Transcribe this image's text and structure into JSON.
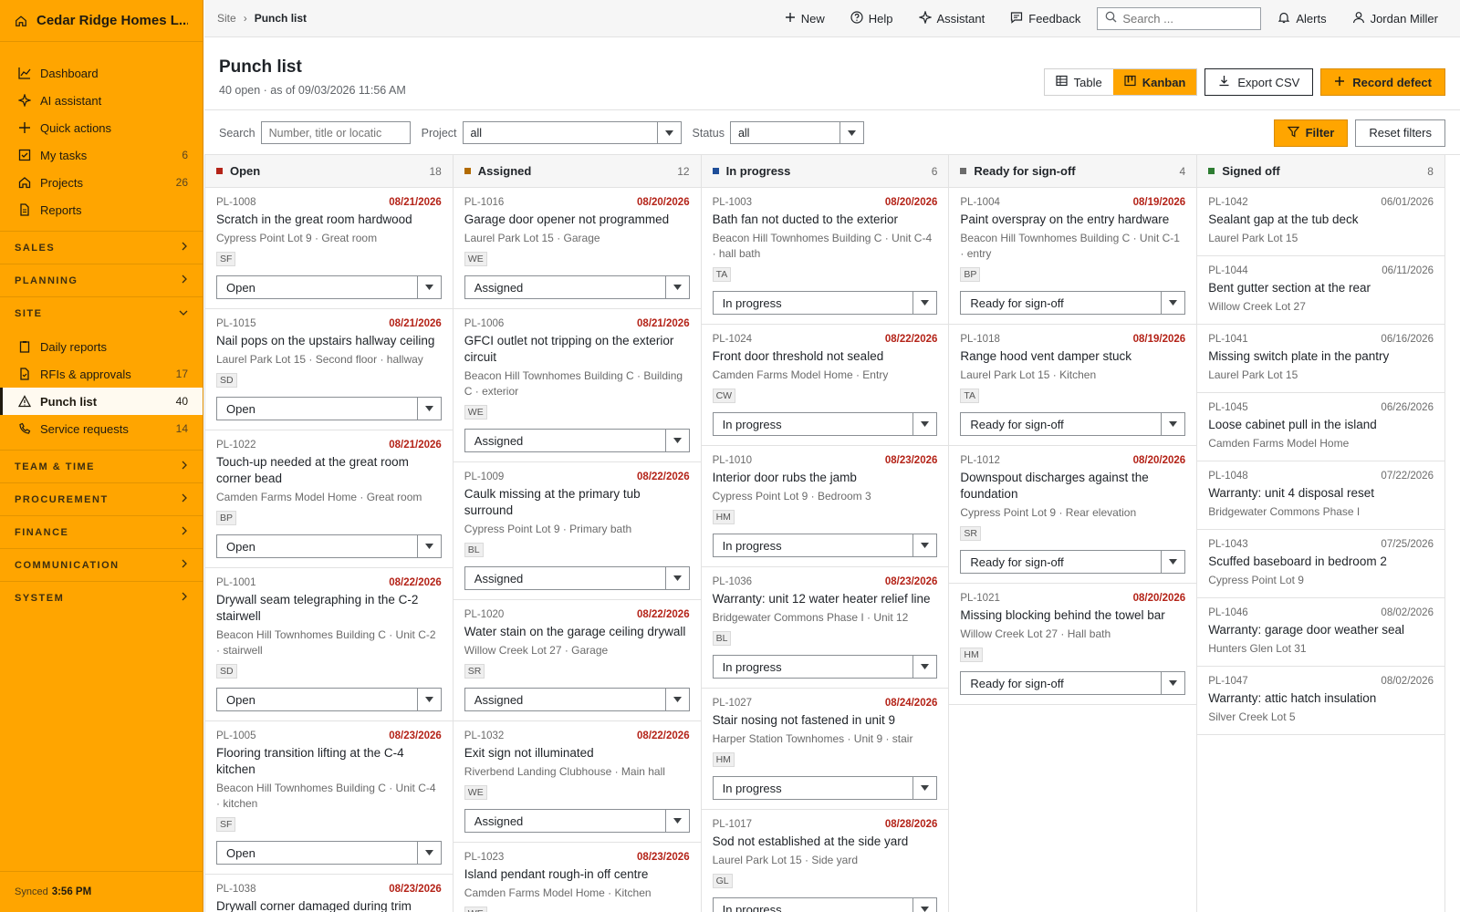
{
  "app": {
    "name": "Cedar Ridge Homes L...",
    "synced_label": "Synced",
    "synced_time": "3:56 PM"
  },
  "sidebar": {
    "top_items": [
      {
        "label": "Dashboard",
        "icon": "chart-line-icon",
        "count": ""
      },
      {
        "label": "AI assistant",
        "icon": "sparkle-icon",
        "count": ""
      },
      {
        "label": "Quick actions",
        "icon": "plus-icon",
        "count": ""
      },
      {
        "label": "My tasks",
        "icon": "checkbox-icon",
        "count": "6"
      },
      {
        "label": "Projects",
        "icon": "home-icon",
        "count": "26"
      },
      {
        "label": "Reports",
        "icon": "document-icon",
        "count": ""
      }
    ],
    "sections": {
      "sales": "SALES",
      "planning": "PLANNING",
      "site": "SITE",
      "team_time": "TEAM & TIME",
      "procurement": "PROCUREMENT",
      "finance": "FINANCE",
      "communication": "COMMUNICATION",
      "system": "SYSTEM"
    },
    "site_items": [
      {
        "label": "Daily reports",
        "icon": "clipboard-icon",
        "count": ""
      },
      {
        "label": "RFIs & approvals",
        "icon": "file-check-icon",
        "count": "17"
      },
      {
        "label": "Punch list",
        "icon": "warning-icon",
        "count": "40"
      },
      {
        "label": "Service requests",
        "icon": "phone-icon",
        "count": "14"
      }
    ]
  },
  "topbar": {
    "breadcrumb_parent": "Site",
    "breadcrumb_sep": "›",
    "breadcrumb_current": "Punch list",
    "new_label": "New",
    "help_label": "Help",
    "assistant_label": "Assistant",
    "feedback_label": "Feedback",
    "search_placeholder": "Search ...",
    "alerts_label": "Alerts",
    "user_name": "Jordan Miller"
  },
  "header": {
    "title": "Punch list",
    "subtitle": "40 open · as of 09/03/2026 11:56 AM",
    "view_table": "Table",
    "view_kanban": "Kanban",
    "export_label": "Export CSV",
    "record_label": "Record defect"
  },
  "filters": {
    "search_label": "Search",
    "search_placeholder": "Number, title or locatic",
    "project_label": "Project",
    "project_value": "all",
    "status_label": "Status",
    "status_value": "all",
    "filter_label": "Filter",
    "reset_label": "Reset filters"
  },
  "colors": {
    "accent": "#ffa500",
    "overdue": "#b42318"
  },
  "columns": [
    {
      "title": "Open",
      "count": "18",
      "color": "#b42318",
      "cards": [
        {
          "id": "PL-1008",
          "date": "08/21/2026",
          "title": "Scratch in the great room hardwood",
          "loc": "Cypress Point Lot 9 · Great room",
          "assignee": "SF",
          "status": "Open"
        },
        {
          "id": "PL-1015",
          "date": "08/21/2026",
          "title": "Nail pops on the upstairs hallway ceiling",
          "loc": "Laurel Park Lot 15 · Second floor · hallway",
          "assignee": "SD",
          "status": "Open"
        },
        {
          "id": "PL-1022",
          "date": "08/21/2026",
          "title": "Touch-up needed at the great room corner bead",
          "loc": "Camden Farms Model Home · Great room",
          "assignee": "BP",
          "status": "Open"
        },
        {
          "id": "PL-1001",
          "date": "08/22/2026",
          "title": "Drywall seam telegraphing in the C-2 stairwell",
          "loc": "Beacon Hill Townhomes Building C · Unit C-2 · stairwell",
          "assignee": "SD",
          "status": "Open"
        },
        {
          "id": "PL-1005",
          "date": "08/23/2026",
          "title": "Flooring transition lifting at the C-4 kitchen",
          "loc": "Beacon Hill Townhomes Building C · Unit C-4 · kitchen",
          "assignee": "SF",
          "status": "Open"
        },
        {
          "id": "PL-1038",
          "date": "08/23/2026",
          "title": "Drywall corner damaged during trim",
          "loc": "",
          "assignee": "",
          "status": ""
        }
      ]
    },
    {
      "title": "Assigned",
      "count": "12",
      "color": "#b26b00",
      "cards": [
        {
          "id": "PL-1016",
          "date": "08/20/2026",
          "title": "Garage door opener not programmed",
          "loc": "Laurel Park Lot 15 · Garage",
          "assignee": "WE",
          "status": "Assigned"
        },
        {
          "id": "PL-1006",
          "date": "08/21/2026",
          "title": "GFCI outlet not tripping on the exterior circuit",
          "loc": "Beacon Hill Townhomes Building C · Building C · exterior",
          "assignee": "WE",
          "status": "Assigned"
        },
        {
          "id": "PL-1009",
          "date": "08/22/2026",
          "title": "Caulk missing at the primary tub surround",
          "loc": "Cypress Point Lot 9 · Primary bath",
          "assignee": "BL",
          "status": "Assigned"
        },
        {
          "id": "PL-1020",
          "date": "08/22/2026",
          "title": "Water stain on the garage ceiling drywall",
          "loc": "Willow Creek Lot 27 · Garage",
          "assignee": "SR",
          "status": "Assigned"
        },
        {
          "id": "PL-1032",
          "date": "08/22/2026",
          "title": "Exit sign not illuminated",
          "loc": "Riverbend Landing Clubhouse · Main hall",
          "assignee": "WE",
          "status": "Assigned"
        },
        {
          "id": "PL-1023",
          "date": "08/23/2026",
          "title": "Island pendant rough-in off centre",
          "loc": "Camden Farms Model Home · Kitchen",
          "assignee": "WE",
          "status": ""
        }
      ]
    },
    {
      "title": "In progress",
      "count": "6",
      "color": "#1f4e99",
      "cards": [
        {
          "id": "PL-1003",
          "date": "08/20/2026",
          "title": "Bath fan not ducted to the exterior",
          "loc": "Beacon Hill Townhomes Building C · Unit C-4 · hall bath",
          "assignee": "TA",
          "status": "In progress"
        },
        {
          "id": "PL-1024",
          "date": "08/22/2026",
          "title": "Front door threshold not sealed",
          "loc": "Camden Farms Model Home · Entry",
          "assignee": "CW",
          "status": "In progress"
        },
        {
          "id": "PL-1010",
          "date": "08/23/2026",
          "title": "Interior door rubs the jamb",
          "loc": "Cypress Point Lot 9 · Bedroom 3",
          "assignee": "HM",
          "status": "In progress"
        },
        {
          "id": "PL-1036",
          "date": "08/23/2026",
          "title": "Warranty: unit 12 water heater relief line",
          "loc": "Bridgewater Commons Phase I · Unit 12",
          "assignee": "BL",
          "status": "In progress"
        },
        {
          "id": "PL-1027",
          "date": "08/24/2026",
          "title": "Stair nosing not fastened in unit 9",
          "loc": "Harper Station Townhomes · Unit 9 · stair",
          "assignee": "HM",
          "status": "In progress"
        },
        {
          "id": "PL-1017",
          "date": "08/28/2026",
          "title": "Sod not established at the side yard",
          "loc": "Laurel Park Lot 15 · Side yard",
          "assignee": "GL",
          "status": "In progress"
        }
      ]
    },
    {
      "title": "Ready for sign-off",
      "count": "4",
      "color": "#6b6b6b",
      "cards": [
        {
          "id": "PL-1004",
          "date": "08/19/2026",
          "title": "Paint overspray on the entry hardware",
          "loc": "Beacon Hill Townhomes Building C · Unit C-1 · entry",
          "assignee": "BP",
          "status": "Ready for sign-off"
        },
        {
          "id": "PL-1018",
          "date": "08/19/2026",
          "title": "Range hood vent damper stuck",
          "loc": "Laurel Park Lot 15 · Kitchen",
          "assignee": "TA",
          "status": "Ready for sign-off"
        },
        {
          "id": "PL-1012",
          "date": "08/20/2026",
          "title": "Downspout discharges against the foundation",
          "loc": "Cypress Point Lot 9 · Rear elevation",
          "assignee": "SR",
          "status": "Ready for sign-off"
        },
        {
          "id": "PL-1021",
          "date": "08/20/2026",
          "title": "Missing blocking behind the towel bar",
          "loc": "Willow Creek Lot 27 · Hall bath",
          "assignee": "HM",
          "status": "Ready for sign-off"
        }
      ]
    },
    {
      "title": "Signed off",
      "count": "8",
      "color": "#2e7d32",
      "cards": [
        {
          "id": "PL-1042",
          "date": "06/01/2026",
          "title": "Sealant gap at the tub deck",
          "loc": "Laurel Park Lot 15",
          "assignee": "",
          "status": ""
        },
        {
          "id": "PL-1044",
          "date": "06/11/2026",
          "title": "Bent gutter section at the rear",
          "loc": "Willow Creek Lot 27",
          "assignee": "",
          "status": ""
        },
        {
          "id": "PL-1041",
          "date": "06/16/2026",
          "title": "Missing switch plate in the pantry",
          "loc": "Laurel Park Lot 15",
          "assignee": "",
          "status": ""
        },
        {
          "id": "PL-1045",
          "date": "06/26/2026",
          "title": "Loose cabinet pull in the island",
          "loc": "Camden Farms Model Home",
          "assignee": "",
          "status": ""
        },
        {
          "id": "PL-1048",
          "date": "07/22/2026",
          "title": "Warranty: unit 4 disposal reset",
          "loc": "Bridgewater Commons Phase I",
          "assignee": "",
          "status": ""
        },
        {
          "id": "PL-1043",
          "date": "07/25/2026",
          "title": "Scuffed baseboard in bedroom 2",
          "loc": "Cypress Point Lot 9",
          "assignee": "",
          "status": ""
        },
        {
          "id": "PL-1046",
          "date": "08/02/2026",
          "title": "Warranty: garage door weather seal",
          "loc": "Hunters Glen Lot 31",
          "assignee": "",
          "status": ""
        },
        {
          "id": "PL-1047",
          "date": "08/02/2026",
          "title": "Warranty: attic hatch insulation",
          "loc": "Silver Creek Lot 5",
          "assignee": "",
          "status": ""
        }
      ]
    }
  ]
}
